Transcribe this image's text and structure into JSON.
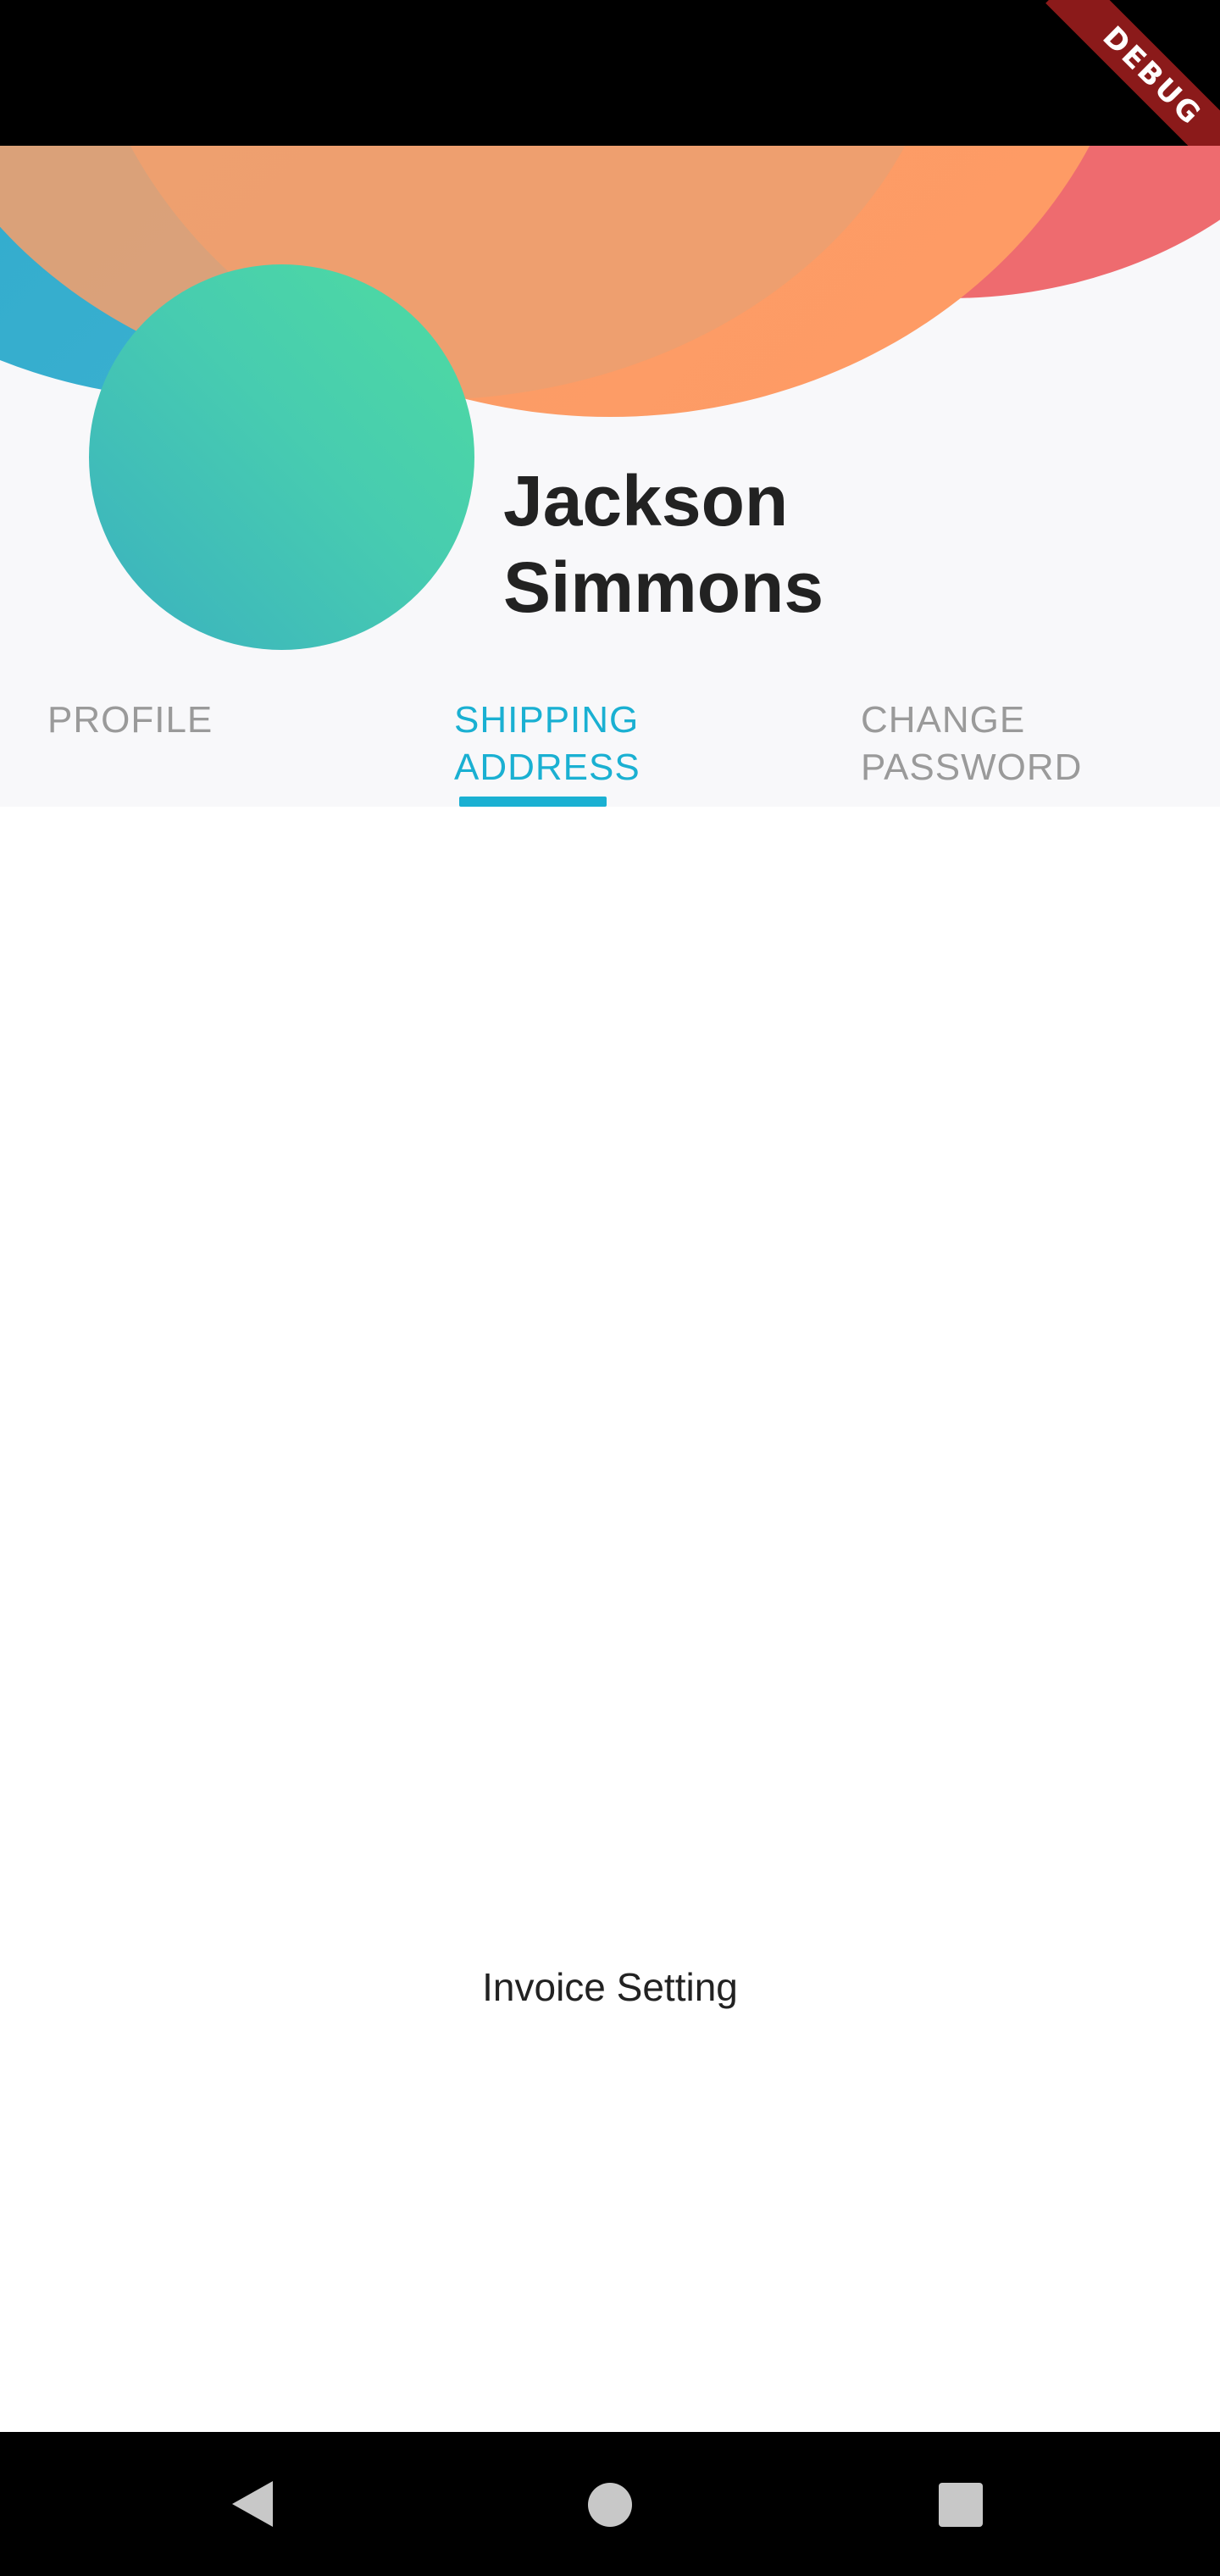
{
  "debug_banner": "DEBUG",
  "profile": {
    "first_name": "Jackson",
    "last_name": "Simmons"
  },
  "tabs": [
    {
      "line1": "PROFILE",
      "line2": "",
      "selected": false
    },
    {
      "line1": "SHIPPING",
      "line2": "ADDRESS",
      "selected": true
    },
    {
      "line1": "CHANGE",
      "line2": "PASSWORD",
      "selected": false
    }
  ],
  "content": {
    "label": "Invoice Setting"
  },
  "colors": {
    "accent": "#1ab0d2",
    "tab_inactive": "#9a9a9a",
    "avatar_start": "#4fdca0",
    "avatar_end": "#3ab0c0",
    "blob_orange": "#ff9a64",
    "blob_blue": "#2aa7c8",
    "blob_red": "#ee6b6f"
  },
  "icons": {
    "nav_back": "back-triangle-icon",
    "nav_home": "home-circle-icon",
    "nav_recents": "recents-square-icon"
  }
}
